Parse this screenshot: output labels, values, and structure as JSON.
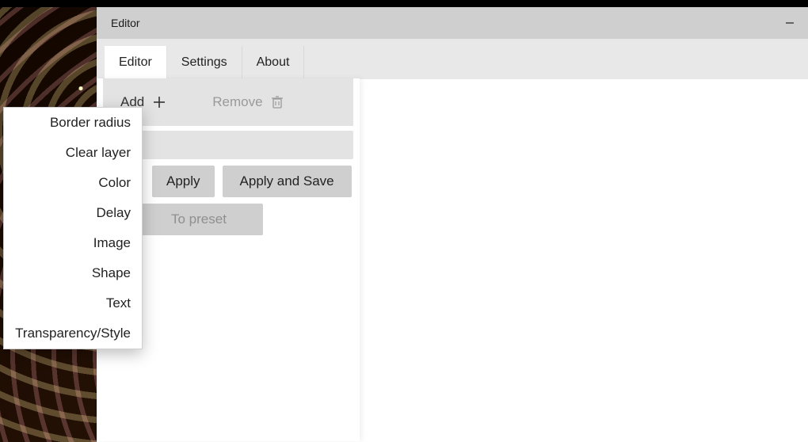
{
  "window": {
    "title": "Editor"
  },
  "tabs": {
    "editor": "Editor",
    "settings": "Settings",
    "about": "About"
  },
  "toolbar": {
    "add": "Add",
    "remove": "Remove"
  },
  "buttons": {
    "apply": "Apply",
    "apply_save": "Apply and Save",
    "to_preset": "To preset"
  },
  "add_menu": {
    "border_radius": "Border radius",
    "clear_layer": "Clear layer",
    "color": "Color",
    "delay": "Delay",
    "image": "Image",
    "shape": "Shape",
    "text": "Text",
    "transparency_style": "Transparency/Style"
  }
}
